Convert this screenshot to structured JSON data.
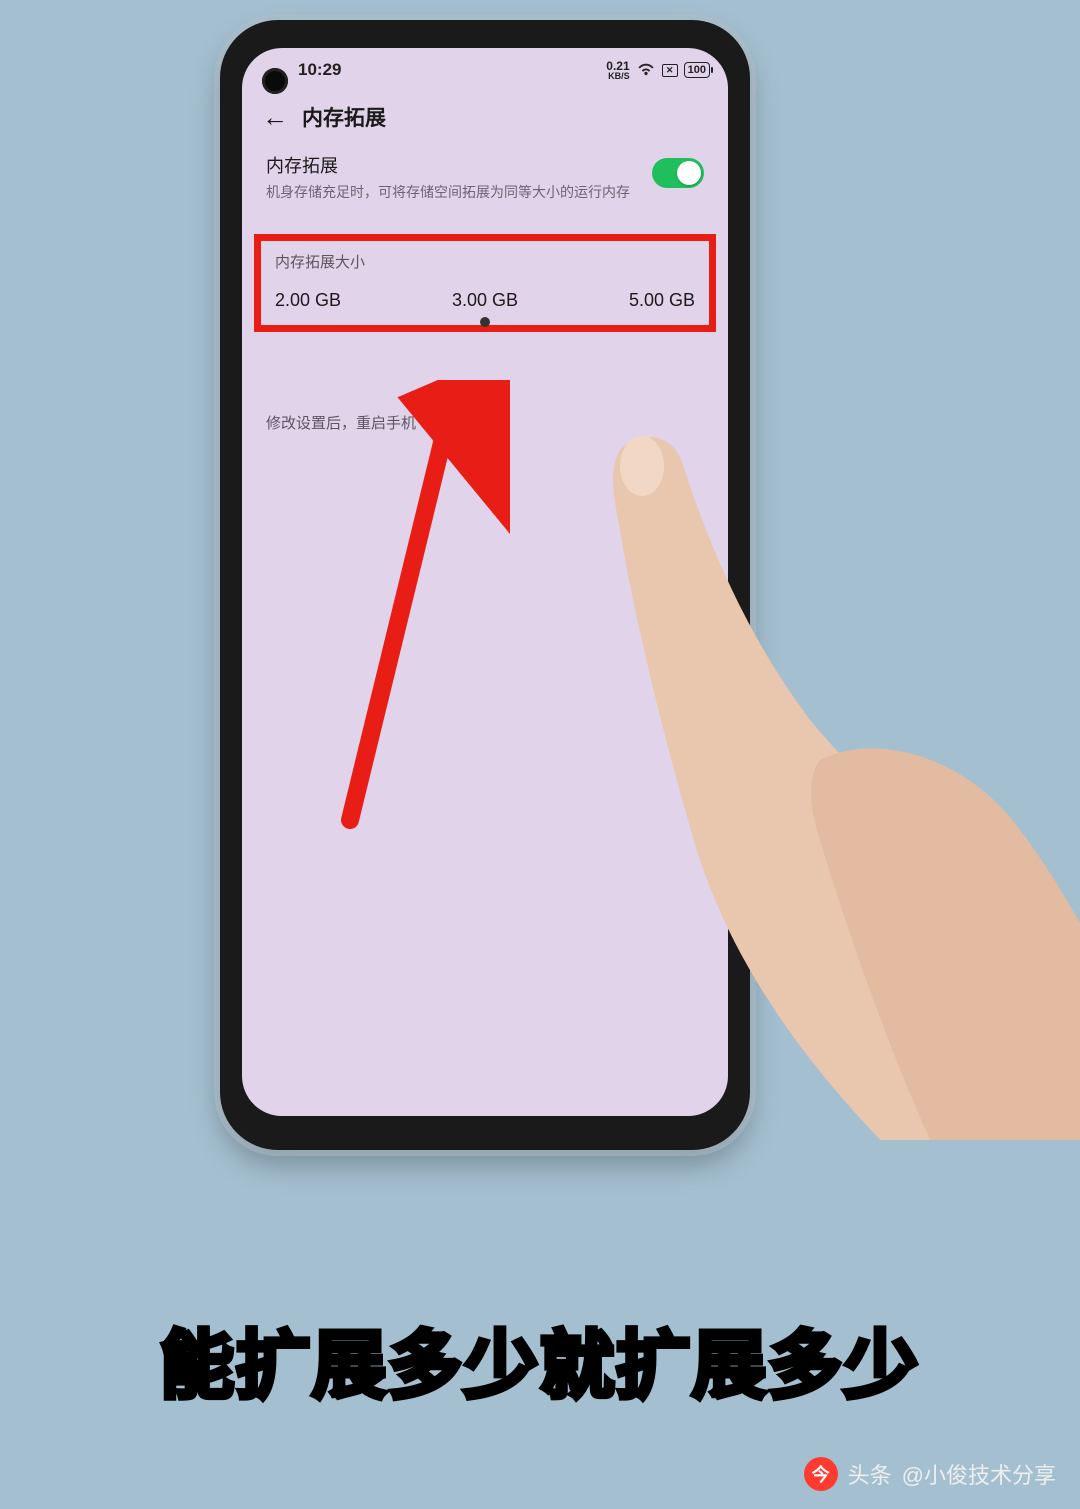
{
  "statusbar": {
    "time": "10:29",
    "speed_value": "0.21",
    "speed_unit": "KB/S",
    "battery": "100"
  },
  "header": {
    "title": "内存拓展"
  },
  "toggle_section": {
    "title": "内存拓展",
    "description": "机身存储充足时，可将存储空间拓展为同等大小的运行内存",
    "enabled": true
  },
  "options": {
    "label": "内存拓展大小",
    "values": [
      "2.00 GB",
      "3.00 GB",
      "5.00 GB"
    ]
  },
  "hint": "修改设置后，重启手机",
  "caption": "能扩展多少就扩展多少",
  "watermark": {
    "source_prefix": "头条",
    "author": "@小俊技术分享"
  }
}
